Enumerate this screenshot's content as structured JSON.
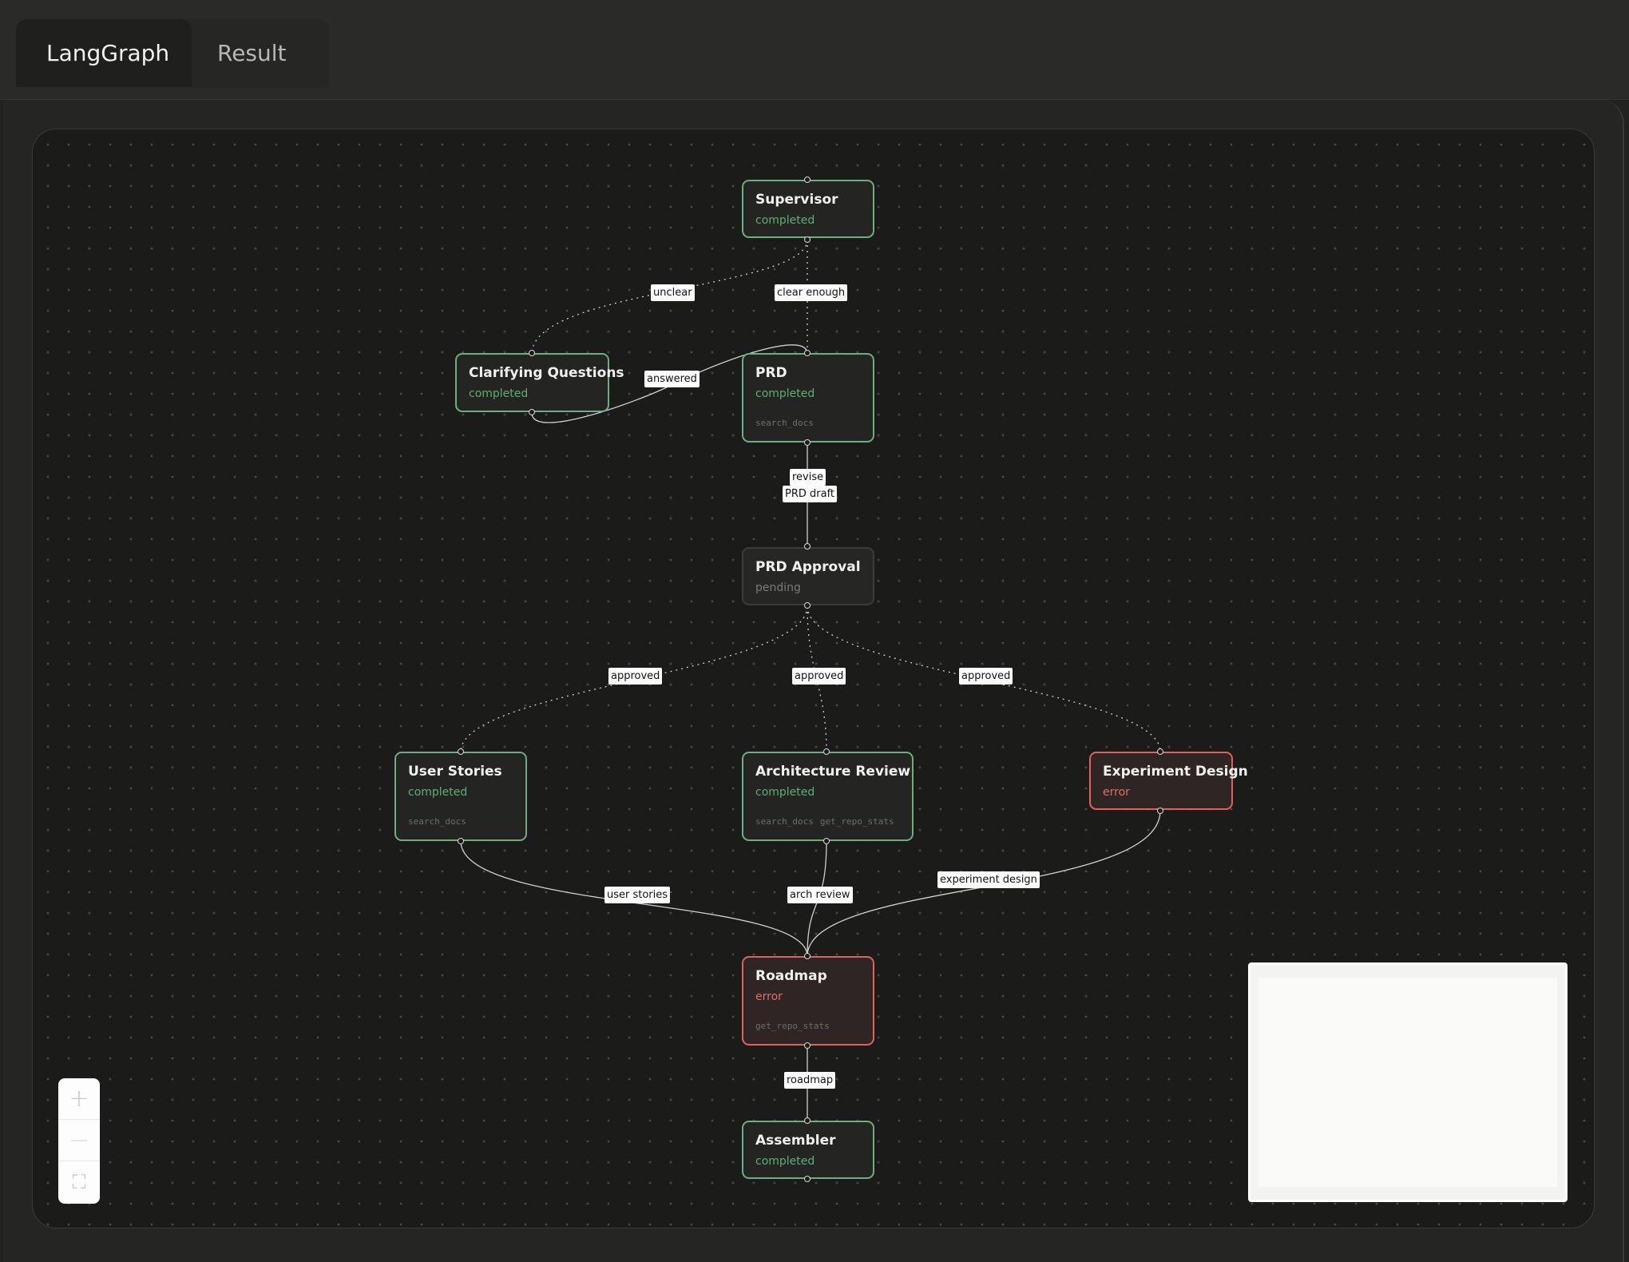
{
  "tabs": [
    {
      "label": "LangGraph",
      "active": true
    },
    {
      "label": "Result",
      "active": false
    }
  ],
  "nodes": {
    "supervisor": {
      "title": "Supervisor",
      "status": "completed",
      "tools": []
    },
    "clarifying": {
      "title": "Clarifying Questions",
      "status": "completed",
      "tools": []
    },
    "prd": {
      "title": "PRD",
      "status": "completed",
      "tools": [
        "search_docs"
      ]
    },
    "prd_approval": {
      "title": "PRD Approval",
      "status": "pending",
      "tools": []
    },
    "user_stories": {
      "title": "User Stories",
      "status": "completed",
      "tools": [
        "search_docs"
      ]
    },
    "arch_review": {
      "title": "Architecture Review",
      "status": "completed",
      "tools": [
        "search_docs",
        "get_repo_stats"
      ]
    },
    "experiment": {
      "title": "Experiment Design",
      "status": "error",
      "tools": []
    },
    "roadmap": {
      "title": "Roadmap",
      "status": "error",
      "tools": [
        "get_repo_stats"
      ]
    },
    "assembler": {
      "title": "Assembler",
      "status": "completed",
      "tools": []
    }
  },
  "edges": {
    "unclear": "unclear",
    "clear_enough": "clear enough",
    "answered": "answered",
    "revise": "revise",
    "prd_draft": "PRD draft",
    "approved_1": "approved",
    "approved_2": "approved",
    "approved_3": "approved",
    "user_stories": "user stories",
    "arch_review": "arch review",
    "experiment_design": "experiment design",
    "roadmap": "roadmap"
  },
  "controls": {
    "zoom_in": "+",
    "zoom_out": "—",
    "fit_view": "⛶"
  },
  "colors": {
    "completed_border": "#6fae7c",
    "error_border": "#e0625a",
    "pending_border": "#3b3b3a",
    "completed_text": "#5fae73",
    "error_text": "#e07066"
  }
}
